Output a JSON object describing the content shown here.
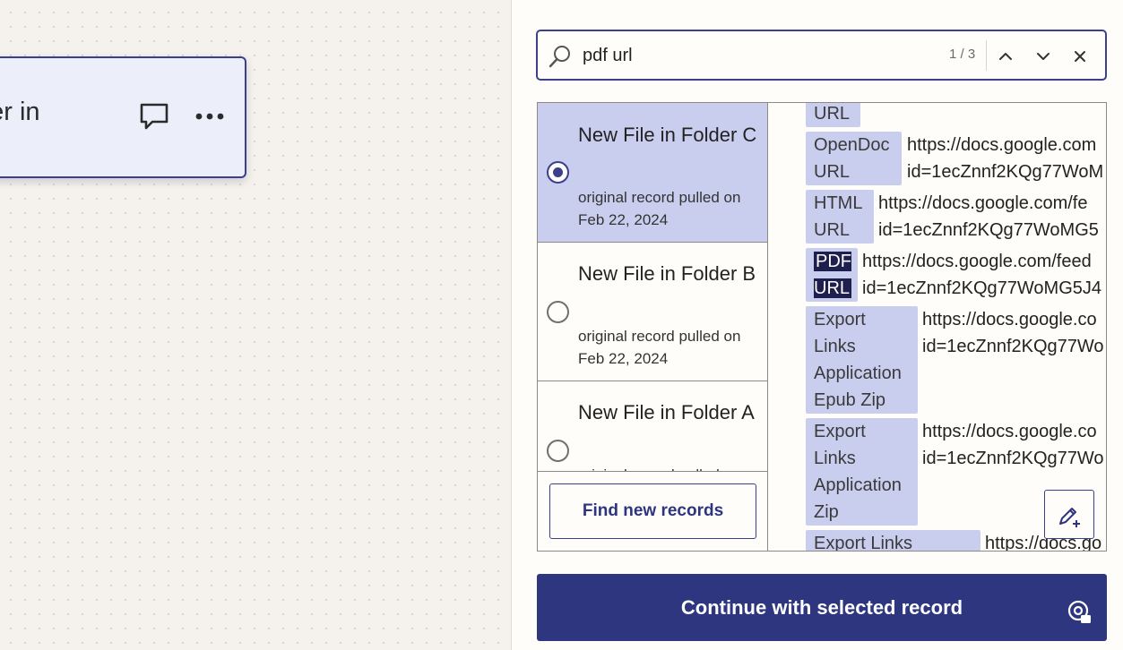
{
  "canvas": {
    "step_card": {
      "title": "der in"
    },
    "comment_icon": "comment-icon",
    "more_icon": "more-options-icon"
  },
  "search": {
    "query": "pdf url",
    "match_count": "1 / 3"
  },
  "records": [
    {
      "title": "New File in Folder C",
      "subtitle": "original record pulled on Feb 22, 2024",
      "selected": true
    },
    {
      "title": "New File in Folder B",
      "subtitle": "original record pulled on Feb 22, 2024",
      "selected": false
    },
    {
      "title": "New File in Folder A",
      "subtitle": "original record pulled on",
      "selected": false
    }
  ],
  "find_new_records_label": "Find new records",
  "fields": [
    {
      "key": "URL",
      "value": ""
    },
    {
      "key": "OpenDoc URL",
      "value": "https://docs.google.com id=1ecZnnf2KQg77WoM"
    },
    {
      "key": "HTML URL",
      "value": "https://docs.google.com/fe id=1ecZnnf2KQg77WoMG5"
    },
    {
      "key": "PDF URL",
      "value": "https://docs.google.com/feed id=1ecZnnf2KQg77WoMG5J4"
    },
    {
      "key": "Export Links Application Epub Zip",
      "value": "https://docs.google.co id=1ecZnnf2KQg77Wo"
    },
    {
      "key": "Export Links Application Zip",
      "value": "https://docs.google.co id=1ecZnnf2KQg77Wo"
    },
    {
      "key": "Export Links",
      "value": "https://docs.go"
    }
  ],
  "continue_label": "Continue with selected record",
  "colors": {
    "accent": "#2f3680",
    "selected_bg": "#c9ceef",
    "highlight": "#1f1f4f"
  }
}
